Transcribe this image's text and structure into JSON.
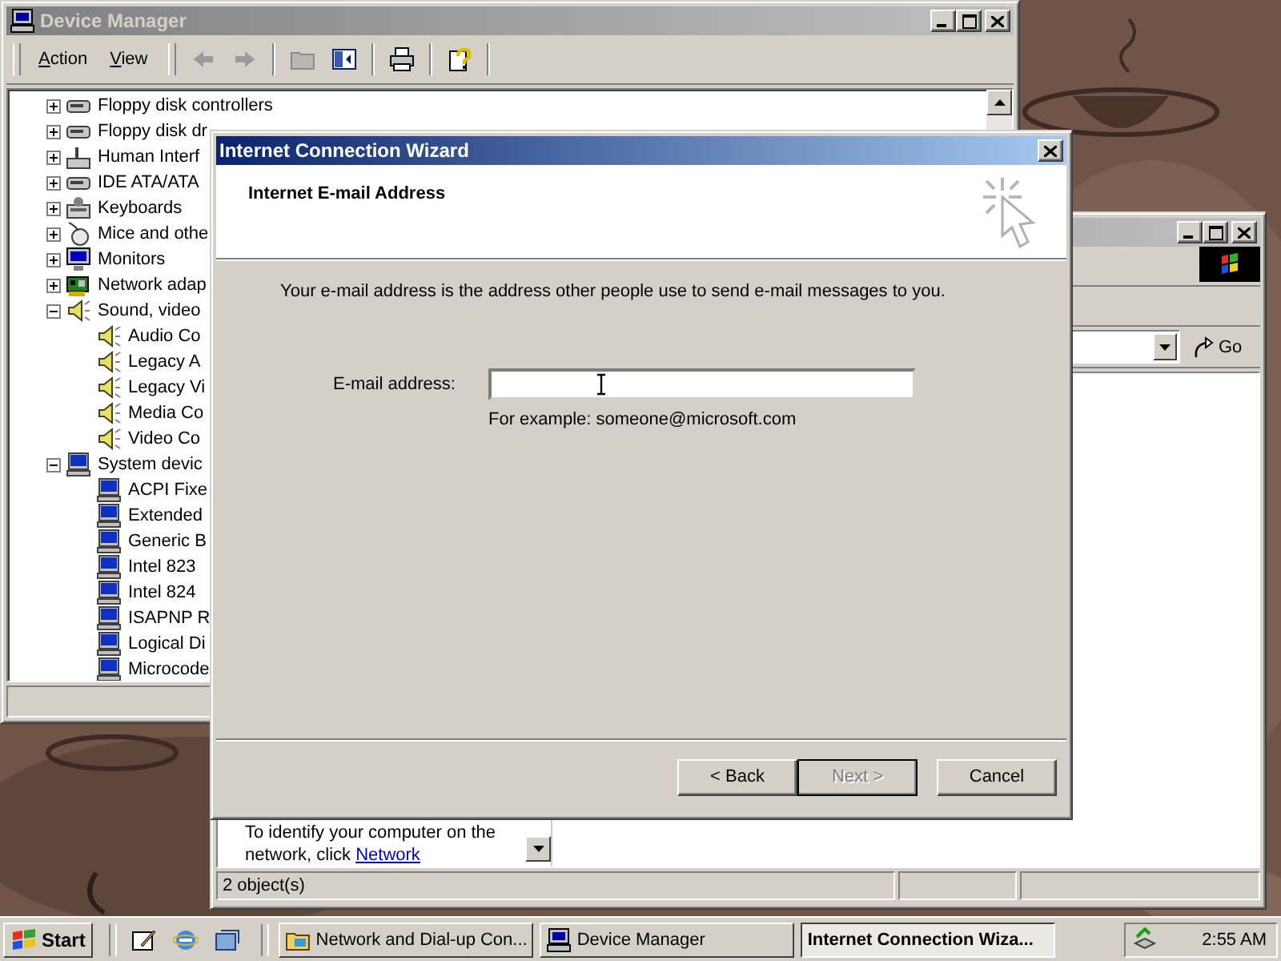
{
  "device_manager": {
    "title": "Device Manager",
    "active": false,
    "menus": [
      "Action",
      "View"
    ],
    "tree": [
      {
        "label": "Floppy disk controllers",
        "kind": "drive",
        "expanded": false
      },
      {
        "label": "Floppy disk dr",
        "kind": "drive",
        "expanded": false
      },
      {
        "label": "Human Interf",
        "kind": "hid",
        "expanded": false
      },
      {
        "label": "IDE ATA/ATA",
        "kind": "drive",
        "expanded": false
      },
      {
        "label": "Keyboards",
        "kind": "keyboard",
        "expanded": false
      },
      {
        "label": "Mice and othe",
        "kind": "mouse",
        "expanded": false
      },
      {
        "label": "Monitors",
        "kind": "monitor",
        "expanded": false
      },
      {
        "label": "Network adap",
        "kind": "network",
        "expanded": false
      },
      {
        "label": "Sound, video",
        "kind": "sound",
        "expanded": true,
        "children": [
          {
            "label": "Audio Co",
            "kind": "sound"
          },
          {
            "label": "Legacy A",
            "kind": "sound"
          },
          {
            "label": "Legacy Vi",
            "kind": "sound"
          },
          {
            "label": "Media Co",
            "kind": "sound"
          },
          {
            "label": "Video Co",
            "kind": "sound"
          }
        ]
      },
      {
        "label": "System devic",
        "kind": "system",
        "expanded": true,
        "children": [
          {
            "label": "ACPI Fixe",
            "kind": "system"
          },
          {
            "label": "Extended",
            "kind": "system"
          },
          {
            "label": "Generic B",
            "kind": "system"
          },
          {
            "label": "Intel 823",
            "kind": "system"
          },
          {
            "label": "Intel 824",
            "kind": "system"
          },
          {
            "label": "ISAPNP R",
            "kind": "system"
          },
          {
            "label": "Logical Di",
            "kind": "system"
          },
          {
            "label": "Microcode",
            "kind": "system"
          }
        ]
      }
    ]
  },
  "network_window": {
    "active": false,
    "info_lines": [
      "To identify your computer on the",
      "network, click"
    ],
    "info_link": "Network",
    "go_button": "Go",
    "status": "2 object(s)"
  },
  "wizard": {
    "title": "Internet Connection Wizard",
    "active": true,
    "heading": "Internet E-mail Address",
    "intro": "Your e-mail address is the address other people use to send e-mail messages to you.",
    "email_label": "E-mail address:",
    "example": "For example: someone@microsoft.com",
    "buttons": [
      {
        "label": "< Back",
        "disabled": false,
        "default": false
      },
      {
        "label": "Next >",
        "disabled": true,
        "default": true
      },
      {
        "label": "Cancel",
        "disabled": false,
        "default": false
      }
    ]
  },
  "taskbar": {
    "start": "Start",
    "tasks": [
      {
        "label": "Network and Dial-up Con...",
        "kind": "folder",
        "selected": false
      },
      {
        "label": "Device Manager",
        "kind": "computer",
        "selected": false
      },
      {
        "label": "Internet Connection Wiza...",
        "kind": "none",
        "selected": true
      }
    ],
    "clock": "2:55 AM"
  }
}
